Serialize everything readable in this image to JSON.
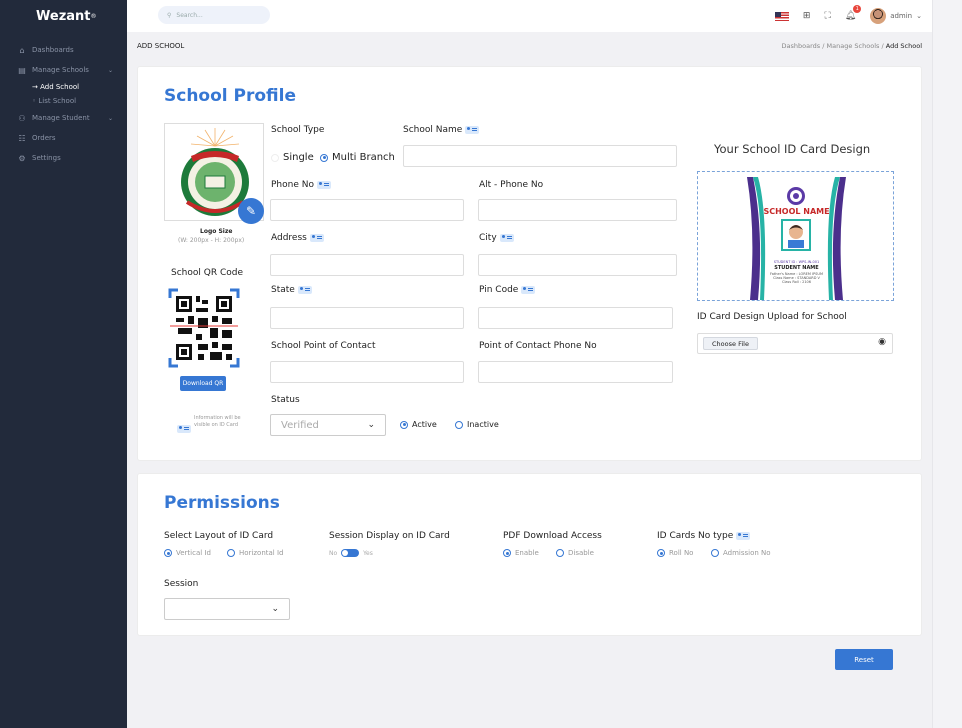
{
  "app": {
    "brand": "Wezant",
    "brand_mark": "®"
  },
  "sidebar": {
    "items": [
      {
        "label": "Dashboards",
        "icon": "home-icon"
      },
      {
        "label": "Manage Schools",
        "icon": "file-icon"
      },
      {
        "label": "→ Add School",
        "icon": ""
      },
      {
        "label": "◦ List School",
        "icon": ""
      },
      {
        "label": "Manage Student",
        "icon": "users-icon"
      },
      {
        "label": "Orders",
        "icon": "grid-icon"
      },
      {
        "label": "Settings",
        "icon": "gear-icon"
      }
    ]
  },
  "topbar": {
    "search_placeholder": "Search...",
    "notification_count": "1",
    "user": "admin"
  },
  "page": {
    "title": "ADD SCHOOL",
    "breadcrumb": [
      "Dashboards",
      "Manage Schools",
      "Add School"
    ],
    "sep": "/"
  },
  "profile": {
    "heading": "School Profile",
    "logo_size_label": "Logo Size",
    "logo_size_value": "(W: 200px - H: 200px)",
    "qr_label": "School QR Code",
    "download_qr": "Download QR",
    "info_note": "Information will be visible on ID Card",
    "school_type_label": "School Type",
    "school_type_options": [
      "Single",
      "Multi Branch"
    ],
    "school_name_label": "School Name",
    "phone_label": "Phone No",
    "alt_phone_label": "Alt - Phone No",
    "address_label": "Address",
    "city_label": "City",
    "state_label": "State",
    "pin_label": "Pin Code",
    "contact_label": "School Point of Contact",
    "contact_phone_label": "Point of Contact Phone No",
    "status_label": "Status",
    "status_value": "Verified",
    "status_options": [
      "Active",
      "Inactive"
    ],
    "id_card_title": "Your School ID Card Design",
    "id_card_upload_label": "ID Card Design Upload for School",
    "choose_file": "Choose File",
    "card_school_name": "SCHOOL NAME",
    "card_student_id": "STUDENT ID : WPS-IN-001",
    "card_student_name": "STUDENT NAME",
    "card_line1": "Father's Name : LOREM IPSUM",
    "card_line2": "Class Name : STANDARD V",
    "card_line3": "Class Roll : 2106"
  },
  "permissions": {
    "heading": "Permissions",
    "layout_label": "Select Layout of ID Card",
    "layout_options": [
      "Vertical Id",
      "Horizontal Id"
    ],
    "session_display_label": "Session Display on ID Card",
    "toggle_no": "No",
    "toggle_yes": "Yes",
    "pdf_label": "PDF Download Access",
    "pdf_options": [
      "Enable",
      "Disable"
    ],
    "idno_label": "ID Cards No type",
    "idno_options": [
      "Roll No",
      "Admission No"
    ],
    "session_label": "Session"
  },
  "actions": {
    "reset": "Reset"
  },
  "colors": {
    "accent": "#3677d3",
    "sidebar": "#222a3b"
  }
}
